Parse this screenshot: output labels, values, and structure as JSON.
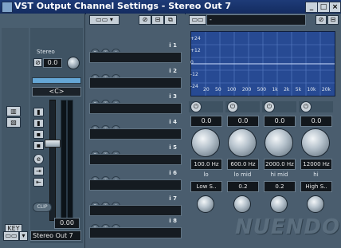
{
  "window": {
    "title": "VST Output Channel Settings - Stereo Out 7",
    "min_label": "_",
    "max_label": "□",
    "close_label": "×"
  },
  "channel_strip": {
    "name_label": "Stereo",
    "gain_value": "0.0",
    "pan_value": "<C>",
    "clip_label": "CLIP",
    "level_value": "0.00",
    "output_name": "Stereo Out 7",
    "strip_buttons": [
      "m",
      "s",
      "r",
      "w",
      "e",
      "f",
      "L",
      "R"
    ]
  },
  "inserts": {
    "slots": [
      {
        "num": "i 1",
        "value": ""
      },
      {
        "num": "i 2",
        "value": ""
      },
      {
        "num": "i 3",
        "value": ""
      },
      {
        "num": "i 4",
        "value": ""
      },
      {
        "num": "i 5",
        "value": ""
      },
      {
        "num": "i 6",
        "value": ""
      },
      {
        "num": "i 7",
        "value": ""
      },
      {
        "num": "i 8",
        "value": ""
      }
    ],
    "icon_labels": [
      "◐",
      "⊤",
      "e"
    ]
  },
  "eq": {
    "preset_value": "-",
    "graph_y_labels": [
      "+24",
      "+12",
      "0",
      "-12",
      "-24"
    ],
    "graph_x_labels": [
      "20",
      "50",
      "100",
      "200",
      "500",
      "1k",
      "2k",
      "5k",
      "10k",
      "20k"
    ],
    "bands": [
      {
        "gain": "0.0",
        "freq": "100.0 Hz",
        "type_label": "lo",
        "mode": "Low S..",
        "q": ""
      },
      {
        "gain": "0.0",
        "freq": "600.0 Hz",
        "type_label": "lo mid",
        "mode": "0.2",
        "q": ""
      },
      {
        "gain": "0.0",
        "freq": "2000.0 Hz",
        "type_label": "hi mid",
        "mode": "0.2",
        "q": ""
      },
      {
        "gain": "0.0",
        "freq": "12000 Hz",
        "type_label": "hi",
        "mode": "High S..",
        "q": ""
      }
    ],
    "band_power_icon": "⏻"
  },
  "brand": {
    "logo_text": "NUENDO"
  },
  "colors": {
    "titlebar": "#1e3b78",
    "graph_bg": "#274a93",
    "panel": "#4a5d6e"
  }
}
